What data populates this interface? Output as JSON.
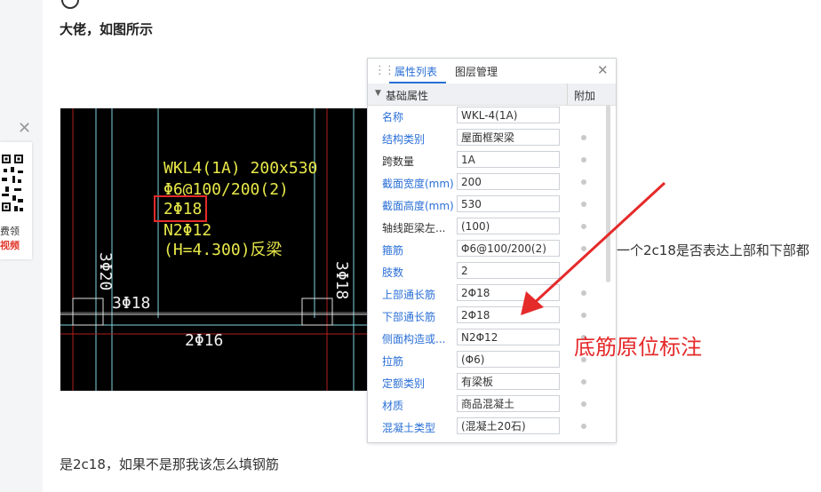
{
  "post": {
    "heading": "大佬，如图所示",
    "question_side": "一个2c18是否表达上部和下部都",
    "question_bottom": "是2c18，如果不是那我该怎么填钢筋"
  },
  "sidebar_promo": {
    "line1": "费领",
    "line2": "视频"
  },
  "cad": {
    "beam_lines": [
      "WKL4(1A) 200x530",
      "Φ6@100/200(2)",
      "2Φ18",
      "N2Φ12",
      "(H=4.300)反梁"
    ],
    "left_vertical": "3Φ20",
    "right_vertical": "3Φ18",
    "bottom_left": "3Φ18",
    "bottom_center": "2Φ16"
  },
  "panel": {
    "tabs": [
      "属性列表",
      "图层管理"
    ],
    "group_title": "基础属性",
    "extra_header": "附加",
    "rows": [
      {
        "name": "名称",
        "value": "WKL-4(1A)",
        "link": true,
        "dot": false
      },
      {
        "name": "结构类别",
        "value": "屋面框架梁",
        "link": true,
        "dot": true
      },
      {
        "name": "跨数量",
        "value": "1A",
        "link": false,
        "dot": true
      },
      {
        "name": "截面宽度(mm)",
        "value": "200",
        "link": true,
        "dot": true
      },
      {
        "name": "截面高度(mm)",
        "value": "530",
        "link": true,
        "dot": true
      },
      {
        "name": "轴线距梁左...",
        "value": "(100)",
        "link": false,
        "dot": true
      },
      {
        "name": "箍筋",
        "value": "Φ6@100/200(2)",
        "link": true,
        "dot": true
      },
      {
        "name": "肢数",
        "value": "2",
        "link": true,
        "dot": false
      },
      {
        "name": "上部通长筋",
        "value": "2Φ18",
        "link": true,
        "dot": true
      },
      {
        "name": "下部通长筋",
        "value": "2Φ18",
        "link": true,
        "dot": true
      },
      {
        "name": "侧面构造或...",
        "value": "N2Φ12",
        "link": true,
        "dot": true
      },
      {
        "name": "拉筋",
        "value": "(Φ6)",
        "link": true,
        "dot": true
      },
      {
        "name": "定额类别",
        "value": "有梁板",
        "link": true,
        "dot": true
      },
      {
        "name": "材质",
        "value": "商品混凝土",
        "link": true,
        "dot": true
      },
      {
        "name": "混凝土类型",
        "value": "(混凝土20石)",
        "link": true,
        "dot": true
      }
    ]
  },
  "annotation": {
    "note": "底筋原位标注",
    "color": "#e52a2a"
  },
  "colors": {
    "link": "#2a6fd6",
    "cad_text": "#e8e84a",
    "cad_line_cyan": "#7fd6e0",
    "cad_line_red": "#b02020"
  }
}
